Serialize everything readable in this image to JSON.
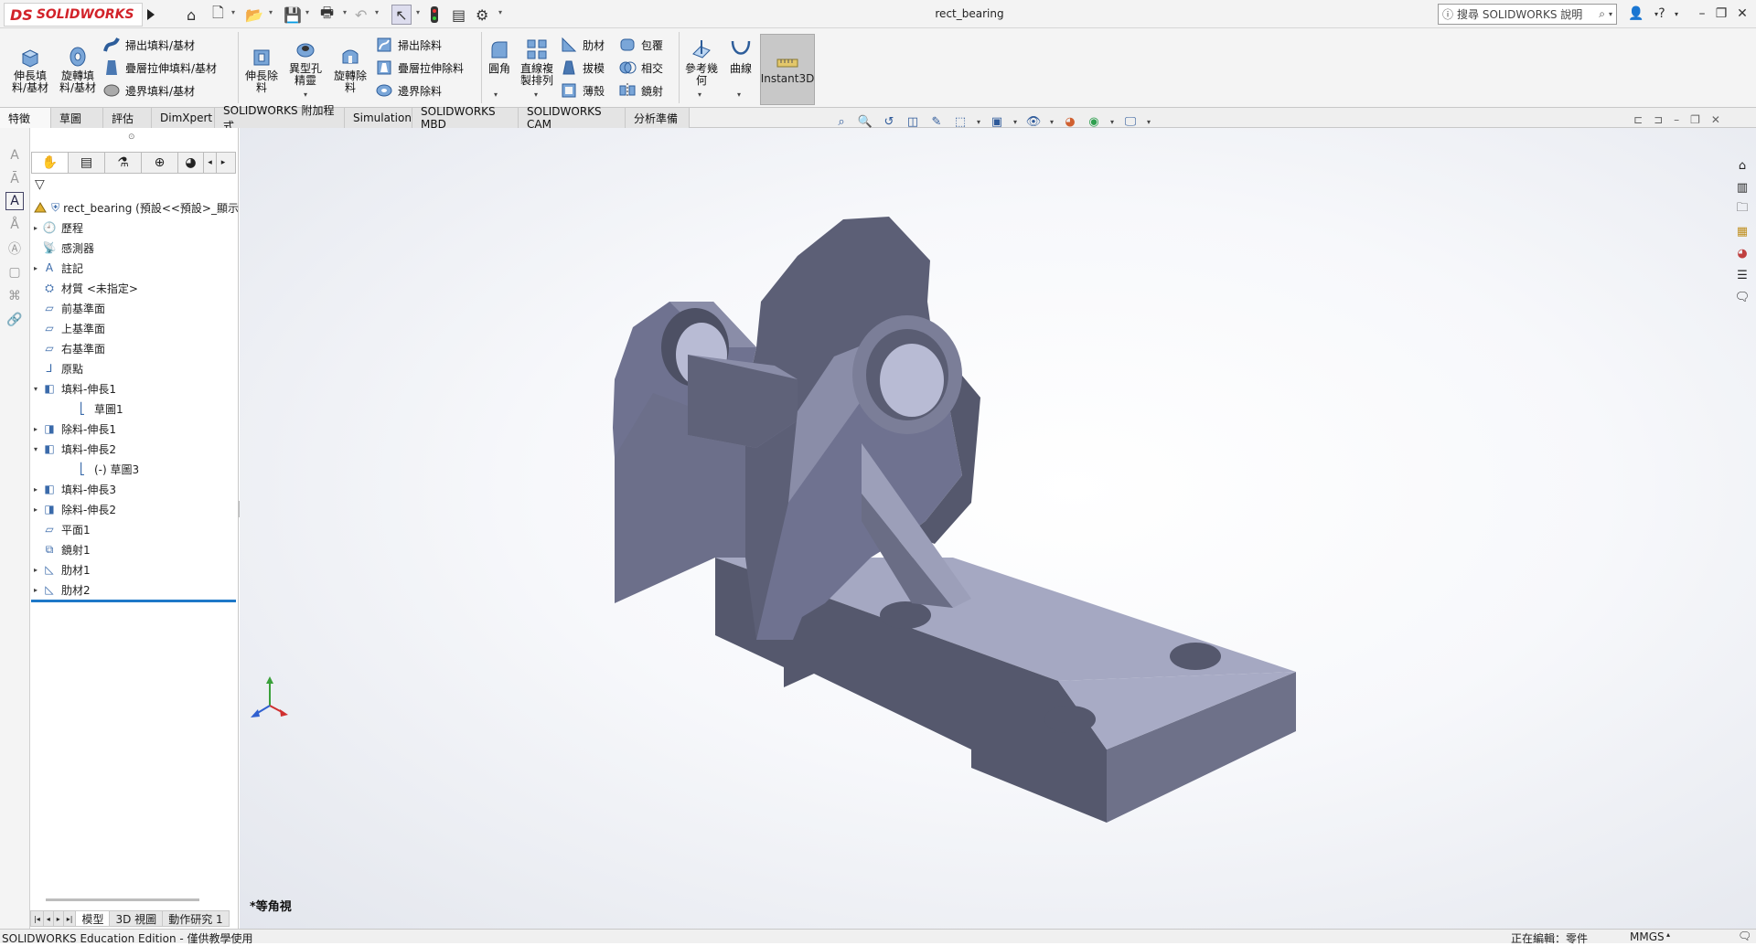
{
  "app": {
    "brand": "SOLIDWORKS",
    "brand_mark": "DS"
  },
  "titlebar": {
    "doc_title": "rect_bearing",
    "search_placeholder": "搜尋 SOLIDWORKS 說明",
    "icons": [
      "home-icon",
      "new-icon",
      "open-icon",
      "save-icon",
      "print-icon",
      "undo-icon",
      "select-icon",
      "traffic-light-icon",
      "options-icon",
      "gear-icon"
    ]
  },
  "ribbon": {
    "extrude_boss": "伸長填料/基材",
    "revolve_boss": "旋轉填料/基材",
    "sweep_boss": "掃出填料/基材",
    "loft_boss": "疊層拉伸填料/基材",
    "boundary_boss": "邊界填料/基材",
    "extrude_cut": "伸長除料",
    "hole_wizard": "異型孔精靈",
    "revolve_cut": "旋轉除料",
    "sweep_cut": "掃出除料",
    "loft_cut": "疊層拉伸除料",
    "boundary_cut": "邊界除料",
    "fillet": "圓角",
    "linear_pattern": "直線複製排列",
    "rib": "肋材",
    "draft": "拔模",
    "shell": "薄殼",
    "wrap": "包覆",
    "intersect": "相交",
    "mirror": "鏡射",
    "ref_geometry": "參考幾何",
    "curves": "曲線",
    "instant3d": "Instant3D"
  },
  "tabs": [
    "特徵",
    "草圖",
    "評估",
    "DimXpert",
    "SOLIDWORKS 附加程式",
    "Simulation",
    "SOLIDWORKS MBD",
    "SOLIDWORKS CAM",
    "分析準備"
  ],
  "tree": {
    "root": "rect_bearing  (預設<<預設>_顯示",
    "items": [
      {
        "label": "歷程",
        "indent": 1,
        "exp": "▸",
        "icon": "history-icon"
      },
      {
        "label": "感測器",
        "indent": 1,
        "exp": "",
        "icon": "sensor-icon"
      },
      {
        "label": "註記",
        "indent": 1,
        "exp": "▸",
        "icon": "annotation-icon"
      },
      {
        "label": "材質 <未指定>",
        "indent": 1,
        "exp": "",
        "icon": "material-icon"
      },
      {
        "label": "前基準面",
        "indent": 1,
        "exp": "",
        "icon": "plane-icon"
      },
      {
        "label": "上基準面",
        "indent": 1,
        "exp": "",
        "icon": "plane-icon"
      },
      {
        "label": "右基準面",
        "indent": 1,
        "exp": "",
        "icon": "plane-icon"
      },
      {
        "label": "原點",
        "indent": 1,
        "exp": "",
        "icon": "origin-icon"
      },
      {
        "label": "填料-伸長1",
        "indent": 1,
        "exp": "▾",
        "icon": "extrude-icon"
      },
      {
        "label": "草圖1",
        "indent": 2,
        "exp": "",
        "icon": "sketch-icon"
      },
      {
        "label": "除料-伸長1",
        "indent": 1,
        "exp": "▸",
        "icon": "cut-extrude-icon"
      },
      {
        "label": "填料-伸長2",
        "indent": 1,
        "exp": "▾",
        "icon": "extrude-icon"
      },
      {
        "label": "(-) 草圖3",
        "indent": 2,
        "exp": "",
        "icon": "sketch-icon"
      },
      {
        "label": "填料-伸長3",
        "indent": 1,
        "exp": "▸",
        "icon": "extrude-icon"
      },
      {
        "label": "除料-伸長2",
        "indent": 1,
        "exp": "▸",
        "icon": "cut-extrude-icon"
      },
      {
        "label": "平面1",
        "indent": 1,
        "exp": "",
        "icon": "plane-icon"
      },
      {
        "label": "鏡射1",
        "indent": 1,
        "exp": "",
        "icon": "mirror-icon"
      },
      {
        "label": "肋材1",
        "indent": 1,
        "exp": "▸",
        "icon": "rib-icon"
      },
      {
        "label": "肋材2",
        "indent": 1,
        "exp": "▸",
        "icon": "rib-icon"
      }
    ]
  },
  "bottom_tabs": [
    "模型",
    "3D 視圖",
    "動作研究 1"
  ],
  "viewport": {
    "view_name": "*等角視"
  },
  "status": {
    "edition": "SOLIDWORKS Education Edition - 僅供教學使用",
    "editing": "正在編輯：零件",
    "units": "MMGS"
  },
  "colors": {
    "accent": "#1e78c8",
    "part_top": "#a4a7c0",
    "part_side": "#6b6e85",
    "part_dark": "#51546a",
    "brand": "#d2232a"
  }
}
